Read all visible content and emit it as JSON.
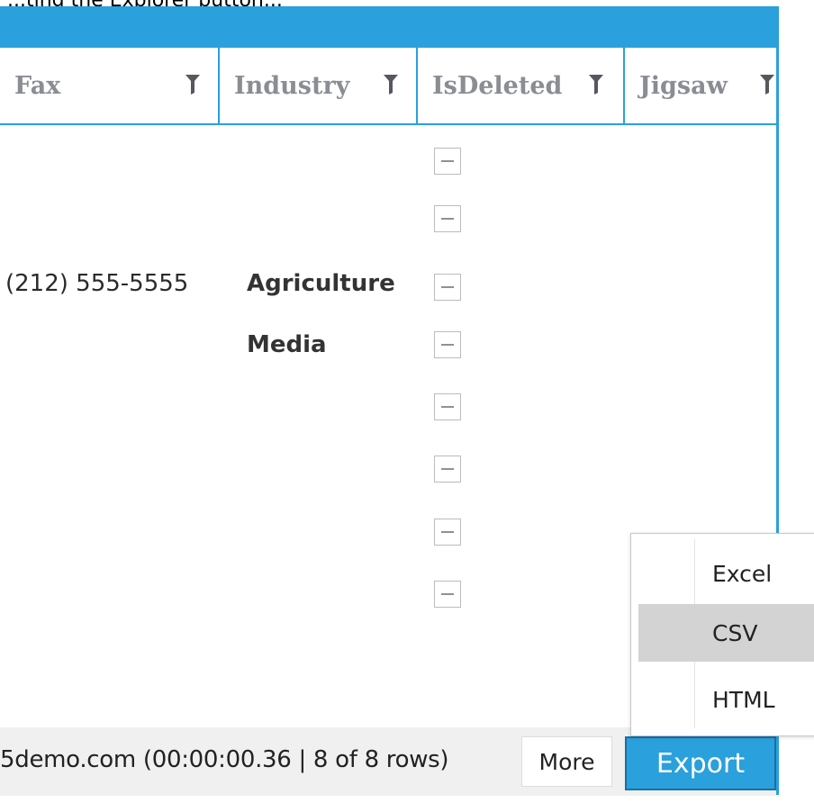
{
  "top_cut_text": "...ting the Explorer button...",
  "colors": {
    "accent": "#2aa0dc",
    "header_text": "#8a8d93",
    "footer_bg": "#f0f0f0",
    "menu_selected": "#d3d3d3"
  },
  "grid": {
    "columns": [
      {
        "label": "Fax",
        "icon": "filter-icon"
      },
      {
        "label": "Industry",
        "icon": "filter-icon"
      },
      {
        "label": "IsDeleted",
        "icon": "filter-icon"
      },
      {
        "label": "Jigsaw",
        "icon": "filter-icon"
      }
    ],
    "rows": [
      {
        "fax": "",
        "industry": "",
        "is_deleted": false,
        "jigsaw": ""
      },
      {
        "fax": "",
        "industry": "",
        "is_deleted": false,
        "jigsaw": ""
      },
      {
        "fax": "(212) 555-5555",
        "industry": "Agriculture",
        "is_deleted": false,
        "jigsaw": ""
      },
      {
        "fax": "",
        "industry": "Media",
        "is_deleted": false,
        "jigsaw": ""
      },
      {
        "fax": "",
        "industry": "",
        "is_deleted": false,
        "jigsaw": ""
      },
      {
        "fax": "",
        "industry": "",
        "is_deleted": false,
        "jigsaw": ""
      },
      {
        "fax": "",
        "industry": "",
        "is_deleted": false,
        "jigsaw": ""
      },
      {
        "fax": "",
        "industry": "",
        "is_deleted": false,
        "jigsaw": ""
      }
    ]
  },
  "footer": {
    "status": "5demo.com (00:00:00.36 | 8 of 8 rows)",
    "more_label": "More",
    "export_label": "Export"
  },
  "export_menu": {
    "items": [
      {
        "label": "Excel",
        "selected": false
      },
      {
        "label": "CSV",
        "selected": true
      },
      {
        "label": "HTML",
        "selected": false
      }
    ]
  }
}
